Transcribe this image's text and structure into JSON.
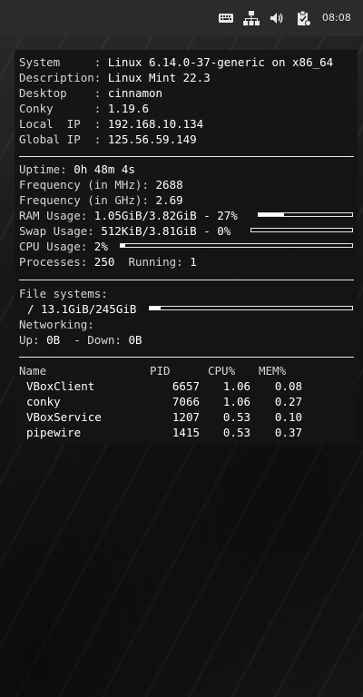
{
  "panel": {
    "clock": "08:08",
    "icons": [
      "keyboard-icon",
      "network-icon",
      "volume-icon",
      "clipboard-icon"
    ]
  },
  "conky": {
    "system": {
      "system_label": "System     :",
      "system_value": "Linux 6.14.0-37-generic on x86_64",
      "description_label": "Description:",
      "description_value": "Linux Mint 22.3",
      "desktop_label": "Desktop    :",
      "desktop_value": "cinnamon",
      "conky_label": "Conky      :",
      "conky_value": "1.19.6",
      "local_ip_label": "Local  IP  :",
      "local_ip_value": "192.168.10.134",
      "global_ip_label": "Global IP  :",
      "global_ip_value": "125.56.59.149"
    },
    "stats": {
      "uptime_label": "Uptime:",
      "uptime_value": "0h 48m 4s",
      "freq_mhz_label": "Frequency (in MHz):",
      "freq_mhz_value": "2688",
      "freq_ghz_label": "Frequency (in GHz):",
      "freq_ghz_value": "2.69",
      "ram_label": "RAM Usage:",
      "ram_value": "1.05GiB/3.82GiB - 27%",
      "ram_fraction": 0.27,
      "swap_label": "Swap Usage:",
      "swap_value": "512KiB/3.81GiB - 0%",
      "swap_fraction": 0.0,
      "cpu_label": "CPU Usage:",
      "cpu_value": "2%",
      "cpu_fraction": 0.02,
      "processes_label": "Processes:",
      "processes_value": "250",
      "running_label": "Running:",
      "running_value": "1"
    },
    "filesystems": {
      "title": "File systems:",
      "root_value": "/ 13.1GiB/245GiB",
      "root_fraction": 0.053,
      "networking_label": "Networking:",
      "up_label": "Up:",
      "up_value": "0B",
      "down_label": "- Down:",
      "down_value": "0B"
    },
    "processes": {
      "headers": {
        "name": "Name",
        "pid": "PID",
        "cpu": "CPU%",
        "mem": "MEM%"
      },
      "rows": [
        {
          "name": "VBoxClient",
          "pid": "6657",
          "cpu": "1.06",
          "mem": "0.08"
        },
        {
          "name": "conky",
          "pid": "7066",
          "cpu": "1.06",
          "mem": "0.27"
        },
        {
          "name": "VBoxService",
          "pid": "1207",
          "cpu": "0.53",
          "mem": "0.10"
        },
        {
          "name": "pipewire",
          "pid": "1415",
          "cpu": "0.53",
          "mem": "0.37"
        }
      ]
    }
  }
}
